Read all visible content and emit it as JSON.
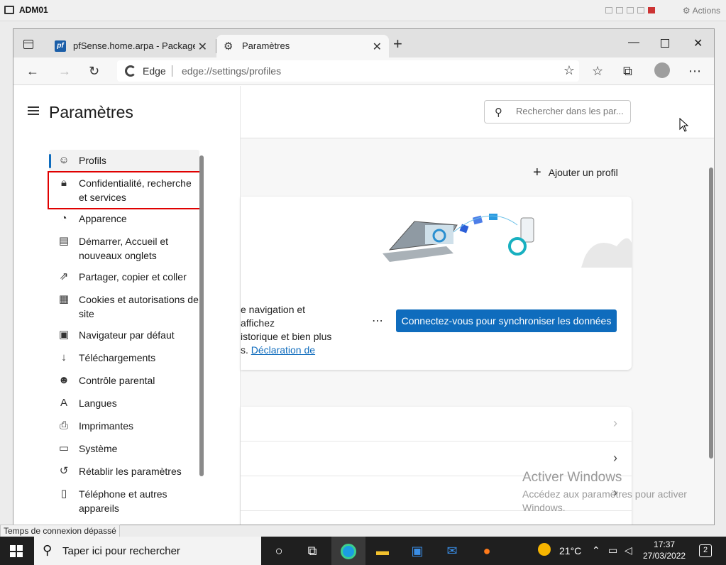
{
  "vm": {
    "title": "ADM01",
    "actions_label": "Actions"
  },
  "browser": {
    "tabs": [
      {
        "label": "pfSense.home.arpa - Package: Pr",
        "favicon": "pf"
      },
      {
        "label": "Paramètres"
      }
    ],
    "address": {
      "site_label": "Edge",
      "url": "edge://settings/profiles"
    }
  },
  "sidebar": {
    "title": "Paramètres",
    "items": [
      {
        "label": "Profils",
        "icon": "profile-icon"
      },
      {
        "label": "Confidentialité, recherche et services",
        "icon": "lock-icon"
      },
      {
        "label": "Apparence",
        "icon": "palette-icon"
      },
      {
        "label": "Démarrer, Accueil et nouveaux onglets",
        "icon": "home-tabs-icon"
      },
      {
        "label": "Partager, copier et coller",
        "icon": "share-icon"
      },
      {
        "label": "Cookies et autorisations de site",
        "icon": "cookies-icon"
      },
      {
        "label": "Navigateur par défaut",
        "icon": "default-browser-icon"
      },
      {
        "label": "Téléchargements",
        "icon": "download-icon"
      },
      {
        "label": "Contrôle parental",
        "icon": "family-icon"
      },
      {
        "label": "Langues",
        "icon": "language-icon"
      },
      {
        "label": "Imprimantes",
        "icon": "printer-icon"
      },
      {
        "label": "Système",
        "icon": "system-icon"
      },
      {
        "label": "Rétablir les paramètres",
        "icon": "reset-icon"
      },
      {
        "label": "Téléphone et autres appareils",
        "icon": "phone-icon"
      }
    ]
  },
  "main": {
    "search_placeholder": "Rechercher dans les par...",
    "add_profile_label": "Ajouter un profil",
    "card": {
      "text_line1": "e navigation et affichez",
      "text_line2": "istorique et bien plus",
      "text_line3_prefix": "s. ",
      "link_label": "Déclaration de",
      "sync_button_label": "Connectez-vous pour synchroniser les données"
    }
  },
  "watermark": {
    "title": "Activer Windows",
    "line1": "Accédez aux paramètres pour activer",
    "line2": "Windows."
  },
  "status_tooltip": "Temps de connexion dépassé",
  "taskbar": {
    "search_placeholder": "Taper ici pour rechercher",
    "weather": "21°C",
    "time": "17:37",
    "date": "27/03/2022",
    "notification_count": "2"
  },
  "colors": {
    "accent": "#0f6cbd",
    "highlight_box": "#e00000"
  }
}
